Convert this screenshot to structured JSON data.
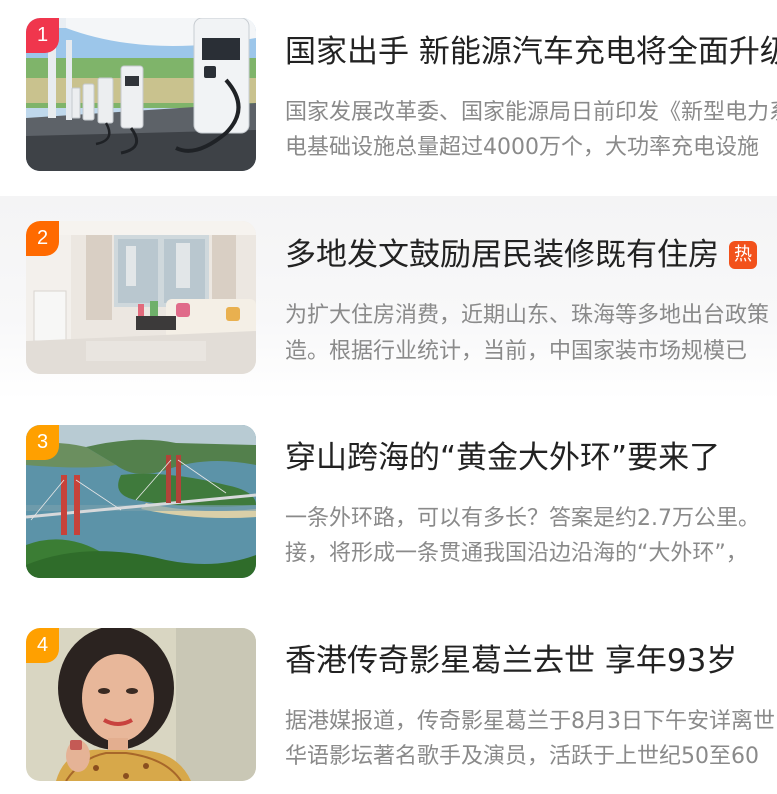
{
  "news": [
    {
      "rank": "1",
      "rank_color": "#f0364d",
      "title": "国家出手 新能源汽车充电将全面升级",
      "desc_line1": "国家发展改革委、国家能源局日前印发《新型电力系统",
      "desc_line2": "电基础设施总量超过4000万个，大功率充电设施",
      "image": "ev-charging-station-photo"
    },
    {
      "rank": "2",
      "rank_color": "#ff6a00",
      "title": "多地发文鼓励居民装修既有住房",
      "badge": "热",
      "badge_color": "#f2511b",
      "desc_line1": "为扩大住房消费，近期山东、珠海等多地出台政策",
      "desc_line2": "造。根据行业统计，当前，中国家装市场规模已",
      "image": "living-room-interior-photo"
    },
    {
      "rank": "3",
      "rank_color": "#ffa000",
      "title": "穿山跨海的“黄金大外环”要来了",
      "desc_line1": "一条外环路，可以有多长？答案是约2.7万公里。",
      "desc_line2": "接，将形成一条贯通我国沿边沿海的“大外环”，",
      "image": "bridge-over-sea-aerial-photo"
    },
    {
      "rank": "4",
      "rank_color": "#ffa000",
      "title": "香港传奇影星葛兰去世 享年93岁",
      "desc_line1": "据港媒报道，传奇影星葛兰于8月3日下午安详离世",
      "desc_line2": "华语影坛著名歌手及演员，活跃于上世纪50至60",
      "image": "actress-portrait-photo"
    }
  ]
}
